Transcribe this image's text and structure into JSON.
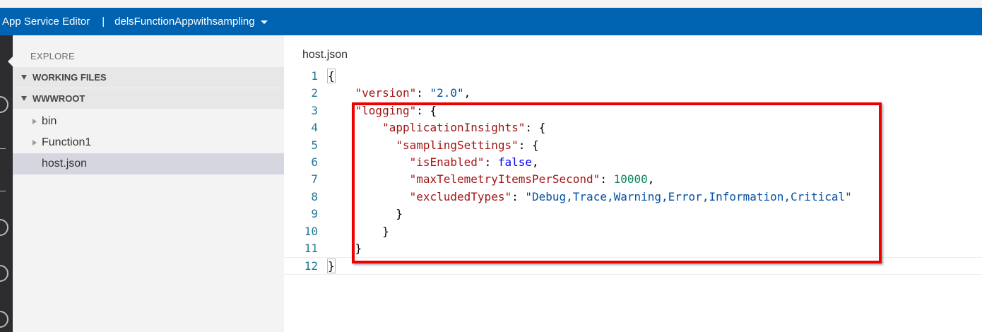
{
  "titlebar": {
    "app_title": "App Service Editor",
    "separator": "|",
    "site_name": "delsFunctionAppwithsampling"
  },
  "activity_bar": {
    "icons": [
      "explore-icon",
      "search-icon",
      "git-icon",
      "console-icon",
      "output-icon",
      "run-icon"
    ]
  },
  "sidebar": {
    "title": "EXPLORE",
    "sections": {
      "working_files": "WORKING FILES",
      "wwwroot": "WWWROOT"
    },
    "tree": [
      {
        "label": "bin",
        "type": "folder"
      },
      {
        "label": "Function1",
        "type": "folder"
      },
      {
        "label": "host.json",
        "type": "file",
        "selected": true
      }
    ]
  },
  "editor": {
    "file_title": "host.json",
    "lines": [
      {
        "n": "1",
        "text": "{"
      },
      {
        "n": "2",
        "text": "    \"version\": \"2.0\","
      },
      {
        "n": "3",
        "text": "    \"logging\": {"
      },
      {
        "n": "4",
        "text": "        \"applicationInsights\": {"
      },
      {
        "n": "5",
        "text": "          \"samplingSettings\": {"
      },
      {
        "n": "6",
        "text": "            \"isEnabled\": false,"
      },
      {
        "n": "7",
        "text": "            \"maxTelemetryItemsPerSecond\": 10000,"
      },
      {
        "n": "8",
        "text": "            \"excludedTypes\": \"Debug,Trace,Warning,Error,Information,Critical\""
      },
      {
        "n": "9",
        "text": "          }"
      },
      {
        "n": "10",
        "text": "        }"
      },
      {
        "n": "11",
        "text": "    }"
      },
      {
        "n": "12",
        "text": "}"
      }
    ],
    "highlight_color": "#ee0000"
  },
  "colors": {
    "titlebar_bg": "#0063b1",
    "sidebar_bg": "#f3f3f3",
    "activity_bg": "#2d2d30",
    "line_number": "#237893",
    "json_key": "#a31515",
    "json_string": "#0451a5",
    "json_number": "#098658",
    "json_keyword": "#0000ff"
  }
}
